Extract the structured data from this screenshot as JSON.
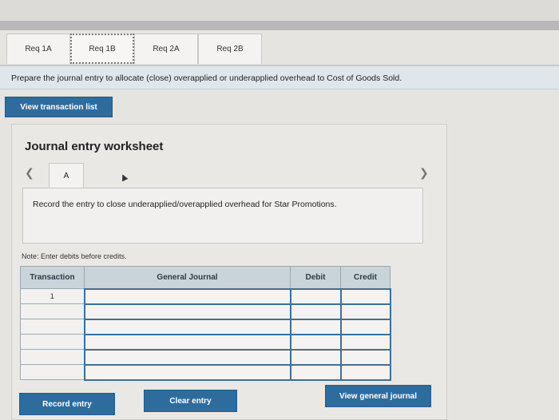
{
  "tabs": [
    {
      "label": "Req 1A",
      "active": false
    },
    {
      "label": "Req 1B",
      "active": true
    },
    {
      "label": "Req 2A",
      "active": false
    },
    {
      "label": "Req 2B",
      "active": false
    }
  ],
  "instruction": "Prepare the journal entry to allocate (close) overapplied or underapplied overhead to Cost of Goods Sold.",
  "buttons": {
    "view_transaction_list": "View transaction list",
    "record_entry": "Record entry",
    "clear_entry": "Clear entry",
    "view_general_journal": "View general journal"
  },
  "worksheet": {
    "title": "Journal entry worksheet",
    "subtab": "A",
    "record_text": "Record the entry to close underapplied/overapplied overhead for Star Promotions.",
    "note": "Note: Enter debits before credits."
  },
  "table": {
    "headers": {
      "transaction": "Transaction",
      "general_journal": "General Journal",
      "debit": "Debit",
      "credit": "Credit"
    },
    "rows": [
      {
        "transaction": "1",
        "account": "",
        "debit": "",
        "credit": ""
      },
      {
        "transaction": "",
        "account": "",
        "debit": "",
        "credit": ""
      },
      {
        "transaction": "",
        "account": "",
        "debit": "",
        "credit": ""
      },
      {
        "transaction": "",
        "account": "",
        "debit": "",
        "credit": ""
      },
      {
        "transaction": "",
        "account": "",
        "debit": "",
        "credit": ""
      },
      {
        "transaction": "",
        "account": "",
        "debit": "",
        "credit": ""
      }
    ]
  },
  "icons": {
    "prev": "chevron-left-icon",
    "next": "chevron-right-icon",
    "cursor": "mouse-cursor-icon"
  },
  "colors": {
    "button": "#2f6c9e",
    "header": "#c9d3da",
    "instruction_bg": "#dfe7ec"
  }
}
